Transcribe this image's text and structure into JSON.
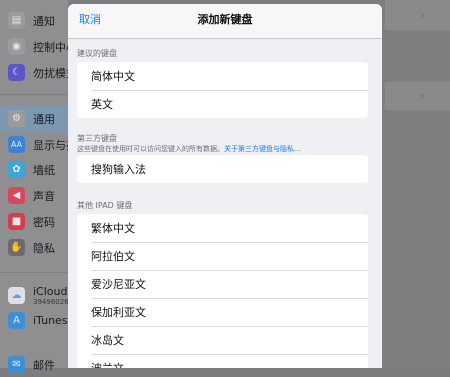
{
  "background": {
    "sidebar_items": [
      {
        "label": "通知",
        "icon": "notifications-icon",
        "color": "#9b9b9e"
      },
      {
        "label": "控制中心",
        "icon": "control-center-icon",
        "color": "#9b9b9e"
      },
      {
        "label": "勿扰模式",
        "icon": "moon-icon",
        "color": "#5b57c8"
      },
      {
        "label": "通用",
        "icon": "gear-icon",
        "color": "#9b9b9e"
      },
      {
        "label": "显示与亮度",
        "icon": "display-icon",
        "color": "#3b82d9"
      },
      {
        "label": "墙纸",
        "icon": "wallpaper-icon",
        "color": "#3ba6d9"
      },
      {
        "label": "声音",
        "icon": "sound-icon",
        "color": "#d9455b"
      },
      {
        "label": "密码",
        "icon": "lock-icon",
        "color": "#d93b4b"
      },
      {
        "label": "隐私",
        "icon": "hand-icon",
        "color": "#6b6b6e"
      },
      {
        "label": "iCloud",
        "sub": "39496026",
        "icon": "cloud-icon",
        "color": "#e0e0e2"
      },
      {
        "label": "iTunes",
        "icon": "appstore-icon",
        "color": "#3b8fd9"
      },
      {
        "label": "邮件",
        "icon": "mail-icon",
        "color": "#3b8fd9"
      }
    ]
  },
  "sheet": {
    "cancel_label": "取消",
    "title": "添加新键盘",
    "suggested_header": "建议的键盘",
    "suggested": [
      "简体中文",
      "英文"
    ],
    "third_party_header": "第三方键盘",
    "third_party_note": "这些键盘在使用时可以访问您键入的所有数据。",
    "third_party_link": "关于第三方键盘与隐私...",
    "third_party": [
      "搜狗输入法"
    ],
    "other_header": "其他 IPAD 键盘",
    "other": [
      "繁体中文",
      "阿拉伯文",
      "爱沙尼亚文",
      "保加利亚文",
      "冰岛文",
      "波兰文"
    ]
  },
  "colors": {
    "accent": "#1a7cf5",
    "sheet_bg": "#efeff4"
  }
}
